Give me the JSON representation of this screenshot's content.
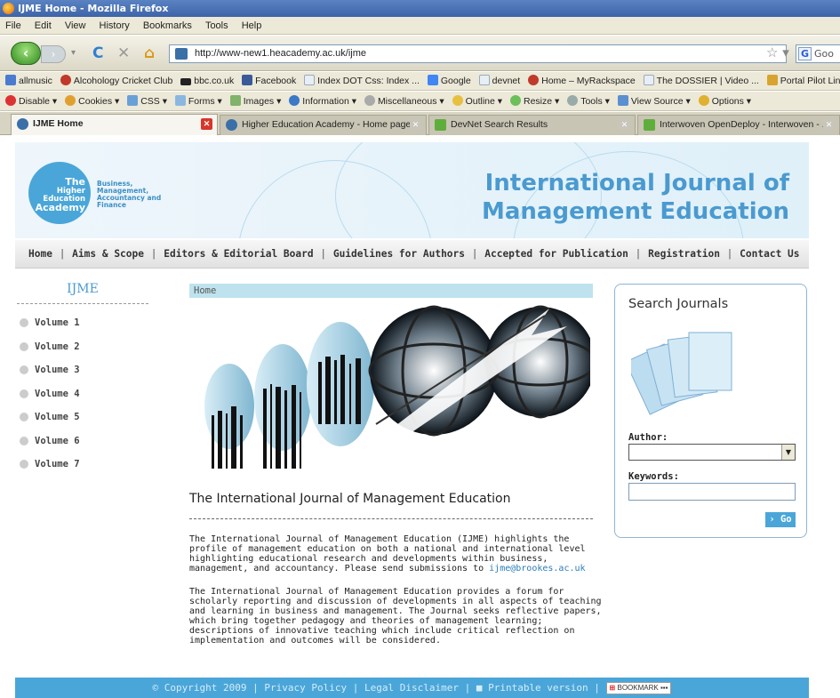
{
  "window": {
    "title": "IJME Home - Mozilla Firefox"
  },
  "menu": [
    "File",
    "Edit",
    "View",
    "History",
    "Bookmarks",
    "Tools",
    "Help"
  ],
  "address": {
    "url": "http://www-new1.heacademy.ac.uk/ijme",
    "search_placeholder": "Goo"
  },
  "bookmarks": [
    "allmusic",
    "Alcohology Cricket Club",
    "bbc.co.uk",
    "Facebook",
    "Index DOT Css: Index ...",
    "Google",
    "devnet",
    "Home – MyRackspace",
    "The DOSSIER | Video ...",
    "Portal Pilot Lin"
  ],
  "webdev_toolbar": [
    "Disable ▾",
    "Cookies ▾",
    "CSS ▾",
    "Forms ▾",
    "Images ▾",
    "Information ▾",
    "Miscellaneous ▾",
    "Outline ▾",
    "Resize ▾",
    "Tools ▾",
    "View Source ▾",
    "Options ▾"
  ],
  "tabs": [
    {
      "label": "IJME Home",
      "active": true
    },
    {
      "label": "Higher Education Academy - Home page",
      "active": false
    },
    {
      "label": "DevNet Search Results",
      "active": false
    },
    {
      "label": "Interwoven OpenDeploy - Interwoven - ...",
      "active": false
    }
  ],
  "site": {
    "logo": {
      "line1": "The",
      "line2": "Higher",
      "line3": "Education",
      "line4": "Academy"
    },
    "logo_tag": [
      "Business,",
      "Management,",
      "Accountancy and",
      "Finance"
    ],
    "journal_title_1": "International Journal of",
    "journal_title_2": "Management Education",
    "nav": [
      "Home",
      "Aims & Scope",
      "Editors & Editorial Board",
      "Guidelines for Authors",
      "Accepted for Publication",
      "Registration",
      "Contact Us"
    ],
    "sidebar_title": "IJME",
    "volumes": [
      "Volume 1",
      "Volume 2",
      "Volume 3",
      "Volume 4",
      "Volume 5",
      "Volume 6",
      "Volume 7"
    ],
    "breadcrumb": "Home",
    "heading": "The International Journal of Management Education",
    "para1_a": "The International Journal of Management Education (IJME) highlights the profile of management education on both a national and international level highlighting educational research and developments within business, management, and accountancy. Please send submissions to ",
    "para1_email": "ijme@brookes.ac.uk",
    "para2": "The International Journal of Management Education provides a forum for scholarly reporting and discussion of developments in all aspects of teaching and learning in business and management. The Journal seeks reflective papers, which bring together pedagogy and theories of management learning; descriptions of innovative teaching which include critical reflection on implementation and outcomes will be considered.",
    "search": {
      "title": "Search Journals",
      "author_label": "Author:",
      "keywords_label": "Keywords:",
      "go_label": "› Go"
    },
    "footer": {
      "copyright": "© Copyright 2009",
      "privacy": "Privacy Policy",
      "legal": "Legal Disclaimer",
      "printable": "Printable version",
      "bookmark_label": "BOOKMARK"
    }
  },
  "colors": {
    "brand_blue": "#4aa6d9",
    "breadcrumb_bg": "#bfe3ee",
    "header_bg": "#eef6fb"
  }
}
